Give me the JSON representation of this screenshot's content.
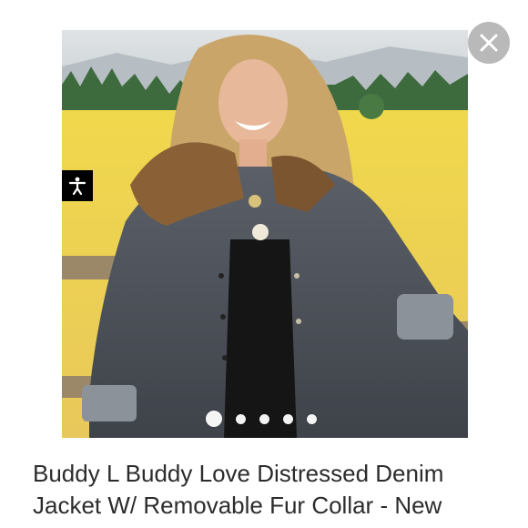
{
  "product": {
    "title_line1": "Buddy L Buddy Love Distressed Denim",
    "title_line2": "Jacket W/ Removable Fur Collar - New"
  },
  "carousel": {
    "image_count": 5,
    "active_index": 0
  },
  "icons": {
    "close": "close-icon",
    "accessibility": "accessibility-icon"
  },
  "colors": {
    "close_button_bg": "#b9b9b9",
    "accessibility_bg": "#000000",
    "title_text": "#2c2c2c"
  }
}
